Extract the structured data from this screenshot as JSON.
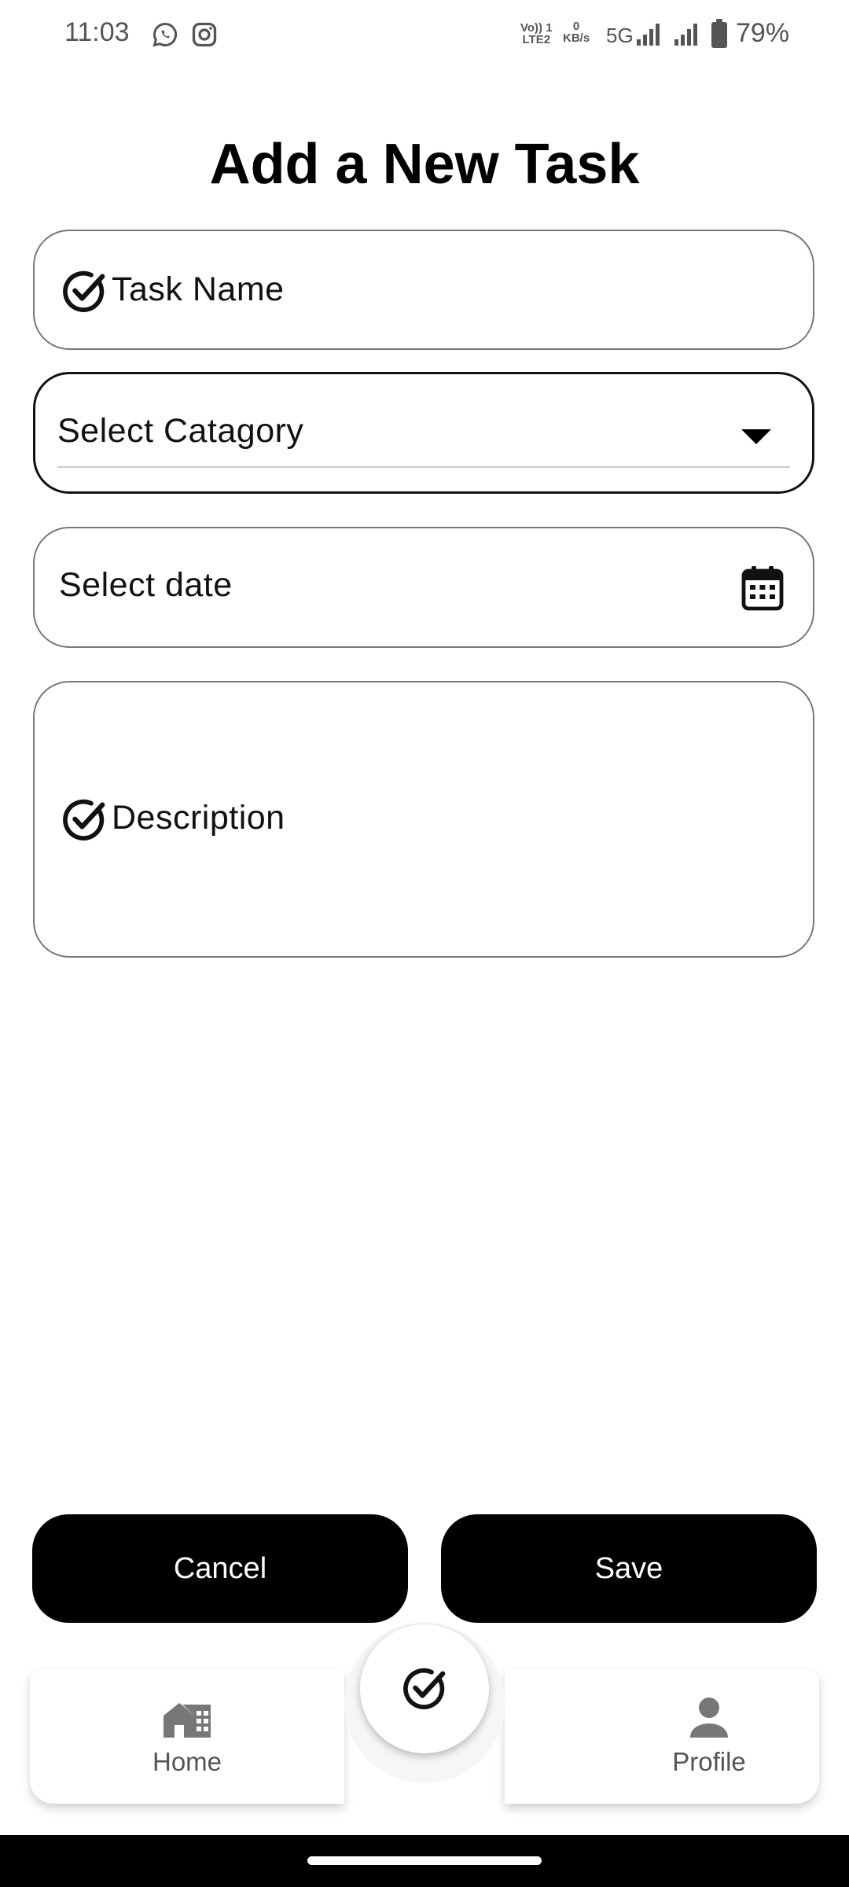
{
  "status_bar": {
    "time": "11:03",
    "network_label_top": "Vo)) 1",
    "network_label_bottom": "LTE2",
    "speed_value": "0",
    "speed_unit": "KB/s",
    "network_type": "5G",
    "battery": "79%",
    "icons": [
      "whatsapp-icon",
      "instagram-icon",
      "signal-icon",
      "signal-icon",
      "battery-icon"
    ]
  },
  "page": {
    "title": "Add a New Task"
  },
  "form": {
    "task_name_placeholder": "Task Name",
    "category_placeholder": "Select Catagory",
    "date_placeholder": "Select date",
    "description_placeholder": "Description"
  },
  "actions": {
    "cancel_label": "Cancel",
    "save_label": "Save"
  },
  "nav": {
    "home_label": "Home",
    "profile_label": "Profile"
  },
  "colors": {
    "primary": "#000000",
    "background": "#ffffff",
    "muted_text": "#555555",
    "field_border": "#777777"
  }
}
